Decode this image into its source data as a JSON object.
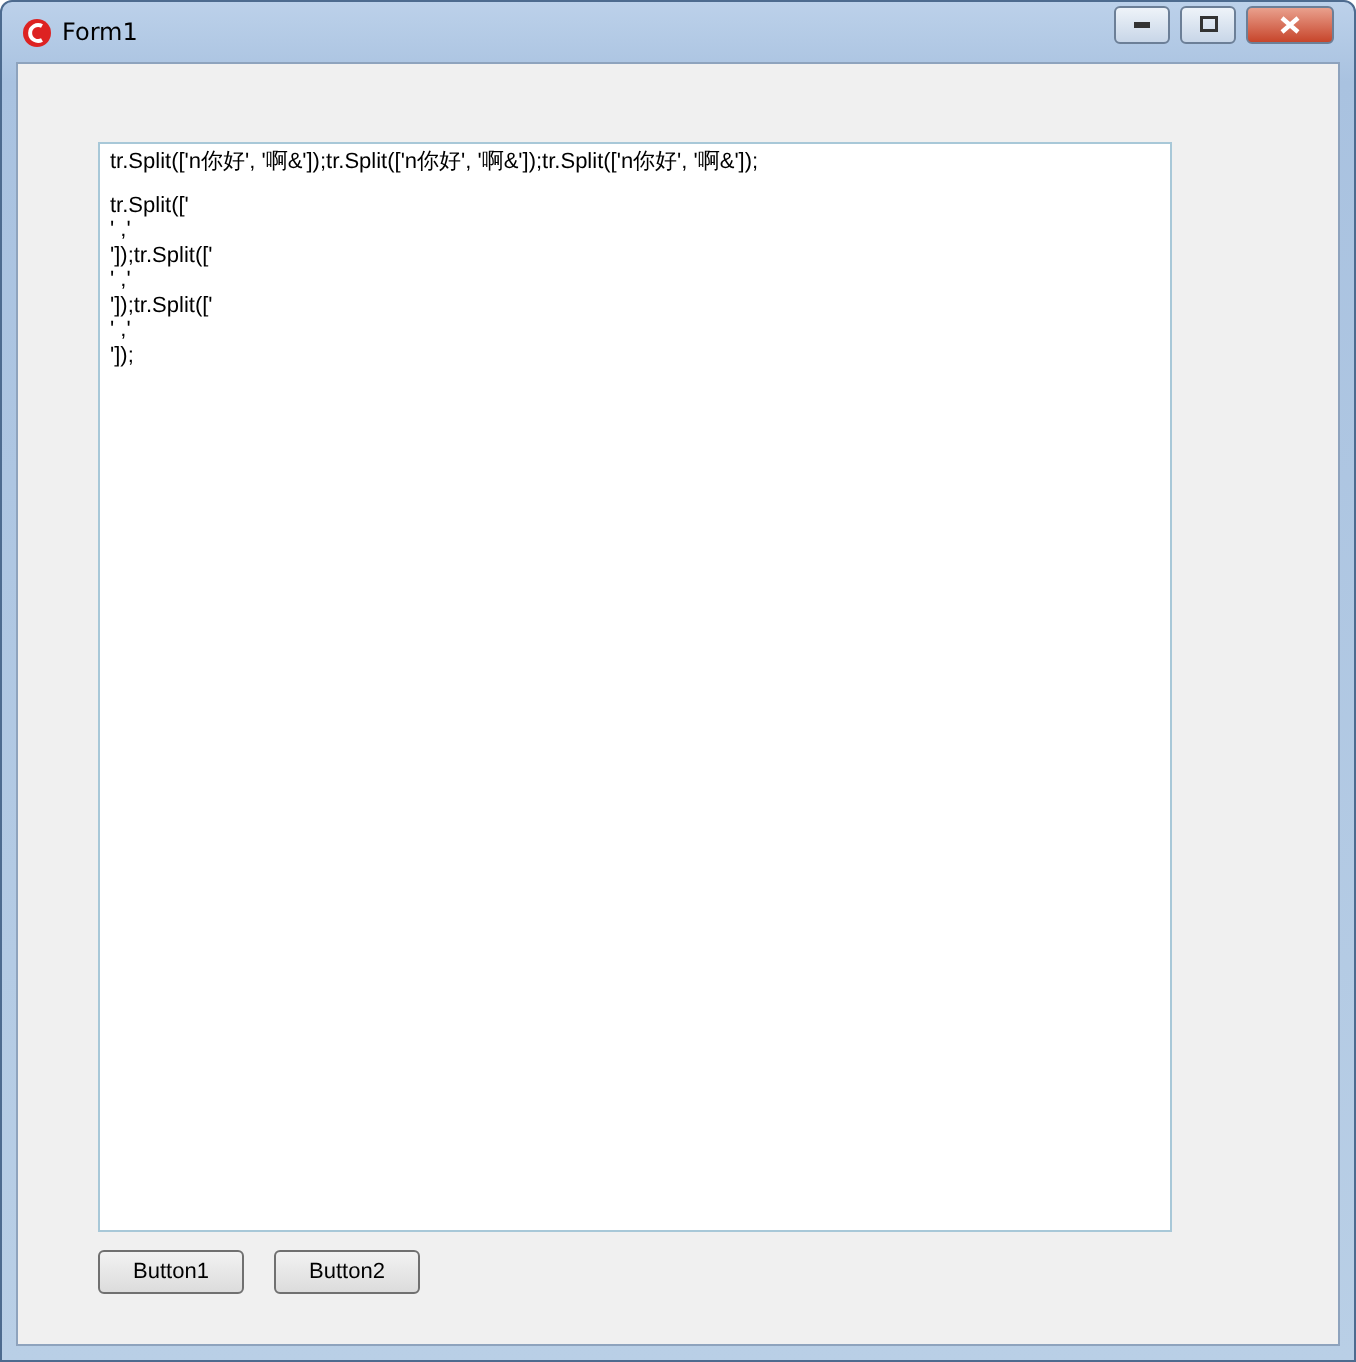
{
  "window": {
    "title": "Form1"
  },
  "text_area": {
    "paragraphs": [
      [
        "tr.Split(['n你好', '啊&']);tr.Split(['n你好', '啊&']);tr.Split(['n你好', '啊&']);"
      ],
      [
        "tr.Split(['",
        "' ,'",
        "']);tr.Split(['",
        "' ,'",
        "']);tr.Split(['",
        "' ,'",
        "']);"
      ]
    ]
  },
  "buttons": [
    "Button1",
    "Button2"
  ]
}
